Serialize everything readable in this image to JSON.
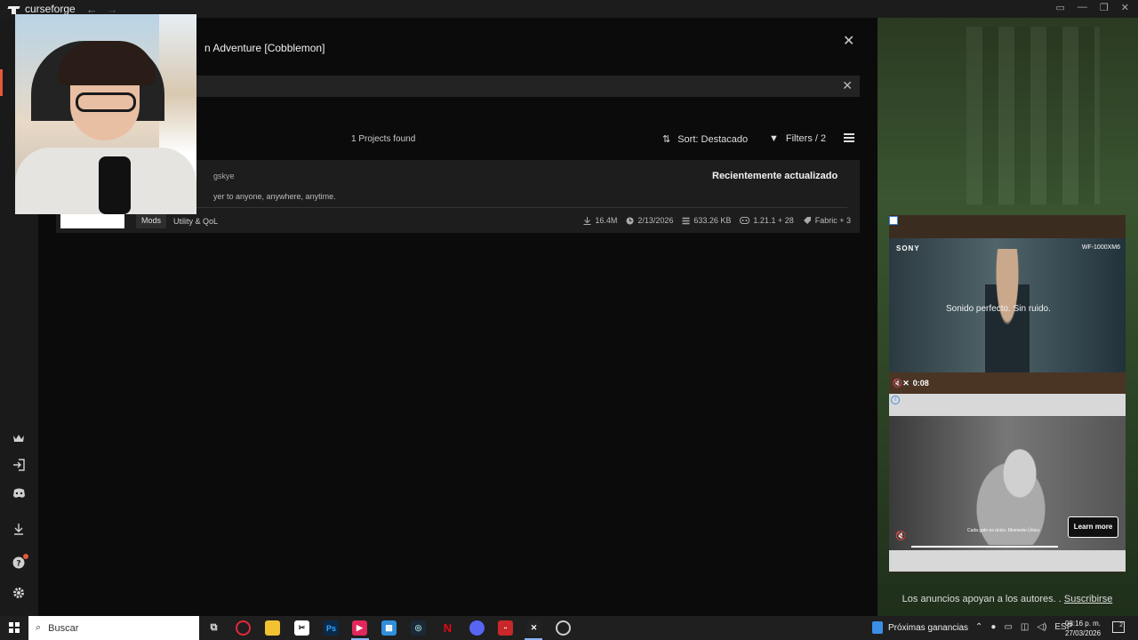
{
  "app": {
    "name": "curseforge",
    "back_icon": "←",
    "forward_icon": "→"
  },
  "window_controls": [
    "▭",
    "—",
    "❐",
    "✕"
  ],
  "modal": {
    "title": "n Adventure [Cobblemon]",
    "close_icon": "✕",
    "search": {
      "value": "",
      "clear_icon": "✕"
    },
    "results_count": "1 Projects found",
    "sort": {
      "icon": "⇅",
      "label": "Sort: Destacado"
    },
    "filters": {
      "icon": "▼",
      "label": "Filters / 2"
    }
  },
  "card": {
    "author": "gskye",
    "description": "yer to anyone, anywhere, anytime.",
    "badge": "Recientemente actualizado",
    "tag": "Mods",
    "category": "Utility & QoL",
    "stats": {
      "downloads": "16.4M",
      "date": "2/13/2026",
      "size": "633.26 KB",
      "versions": "1.21.1 + 28",
      "loader": "Fabric + 3"
    }
  },
  "ads": {
    "video": {
      "brand": "SONY",
      "model": "WF-1000XM6",
      "caption": "Sonido perfecto. Sin ruido.",
      "mute_icon": "🔇✕",
      "time": "0:08"
    },
    "banner": {
      "info_icon": "i",
      "caption": "Cada gato es único. Momento Único.",
      "mute_icon": "🔇",
      "cta": "Learn more"
    },
    "note": "Los anuncios apoyan a los autores. .",
    "subscribe_link": "Suscribirse"
  },
  "taskbar": {
    "search_placeholder": "Buscar",
    "news": "Próximas ganancias",
    "lang": "ESP",
    "time": "08:16 p. m.",
    "date": "27/03/2026",
    "notif_count": "2"
  },
  "colors": {
    "accent": "#e5583a",
    "modal_bg": "#0b0b0b",
    "card_bg": "#1d1d1d"
  }
}
